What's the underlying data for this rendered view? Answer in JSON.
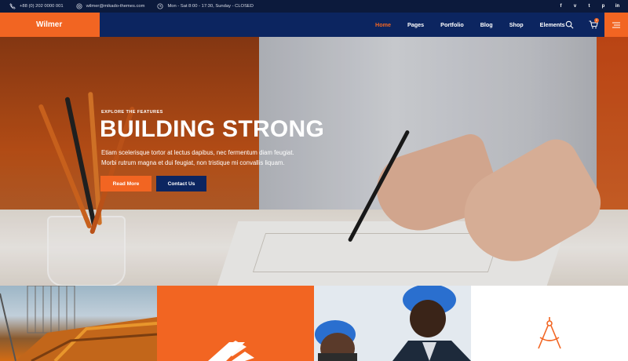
{
  "topbar": {
    "phone": "+88 (0) 202 0000 001",
    "email": "wilmer@mikado-themes.com",
    "hours": "Mon - Sat 8:00 - 17:30, Sunday - CLOSED",
    "social": [
      "f",
      "v",
      "t",
      "p",
      "in"
    ]
  },
  "header": {
    "logo": "Wilmer",
    "menu": [
      "Home",
      "Pages",
      "Portfolio",
      "Blog",
      "Shop",
      "Elements"
    ],
    "active_item": "Home",
    "cart_count": "0",
    "icons": [
      "search-icon",
      "cart-icon",
      "menu-icon"
    ]
  },
  "hero": {
    "kicker": "EXPLORE THE FEATURES",
    "title": "BUILDING STRONG",
    "subtitle_line1": "Etiam scelerisque tortor at lectus dapibus, nec fermentum diam feugiat.",
    "subtitle_line2": "Morbi rutrum magna et dui feugiat, non tristique mi convallis liquam.",
    "primary_button": "Read More",
    "secondary_button": "Contact Us"
  },
  "tiles": [
    "construction-photo",
    "logo-tile",
    "workers-photo",
    "compass-icon-tile"
  ],
  "colors": {
    "accent": "#f26522",
    "navy": "#0c2560",
    "topbar": "#0c1a3c"
  }
}
